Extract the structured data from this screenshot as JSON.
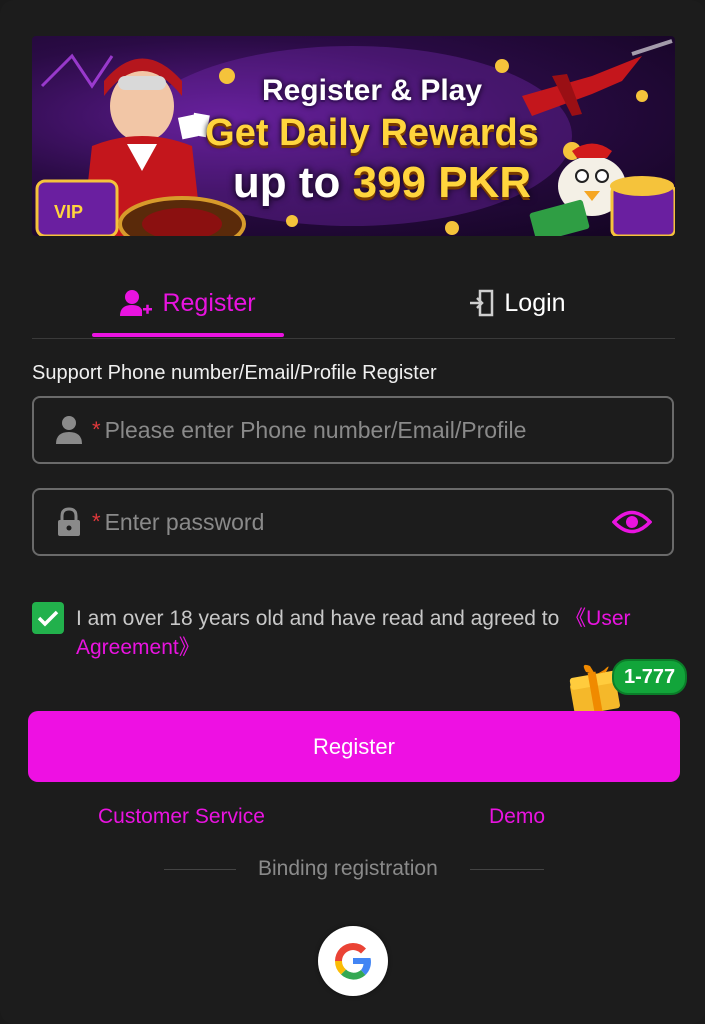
{
  "banner": {
    "line1": "Register & Play",
    "line2": "Get Daily Rewards",
    "line3_prefix": "up to ",
    "line3_amount": "399 PKR",
    "vip_label": "VIP"
  },
  "tabs": [
    {
      "label": "Register",
      "active": true,
      "icon": "add-user-icon"
    },
    {
      "label": "Login",
      "active": false,
      "icon": "login-icon"
    }
  ],
  "form": {
    "hint": "Support Phone number/Email/Profile Register",
    "username": {
      "required_mark": "*",
      "placeholder": "Please enter Phone number/Email/Profile",
      "value": "",
      "icon": "user-icon"
    },
    "password": {
      "required_mark": "*",
      "placeholder": "Enter password",
      "value": "",
      "icon": "lock-icon",
      "toggle_icon": "eye-icon"
    },
    "agreement": {
      "checked": true,
      "text": "I am over 18 years old and have read and agreed to ",
      "link": "《User Agreement》"
    },
    "promo_badge": "1-777",
    "submit_label": "Register"
  },
  "links": {
    "customer_service": "Customer Service",
    "demo": "Demo"
  },
  "binding": {
    "label": "Binding registration",
    "providers": [
      "google-icon"
    ]
  },
  "colors": {
    "accent": "#ee10e3",
    "background": "#1c1c1c",
    "check": "#22b14c",
    "badge": "#12a53a",
    "required": "#e0383b"
  }
}
